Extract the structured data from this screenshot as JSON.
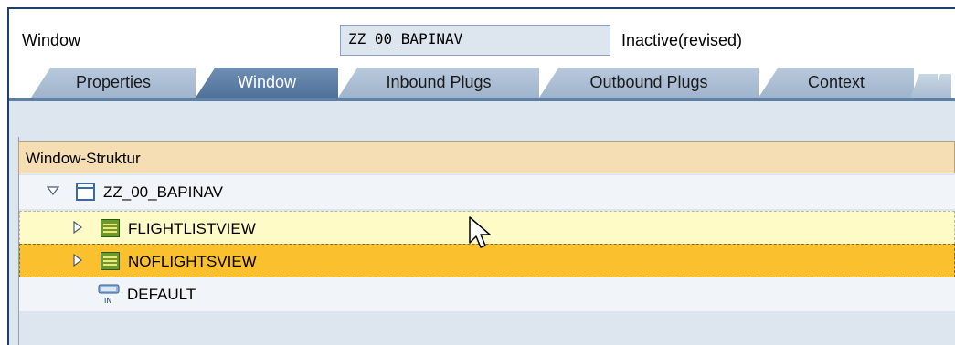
{
  "header": {
    "label": "Window",
    "input_value": "ZZ_00_BAPINAV",
    "status": "Inactive(revised)"
  },
  "tabs": [
    {
      "label": "Properties",
      "active": false
    },
    {
      "label": "Window",
      "active": true
    },
    {
      "label": "Inbound Plugs",
      "active": false
    },
    {
      "label": "Outbound Plugs",
      "active": false
    },
    {
      "label": "Context",
      "active": false
    }
  ],
  "tree": {
    "column_header": "Window-Struktur",
    "root": {
      "label": "ZZ_00_BAPINAV",
      "icon": "window-icon",
      "expanded": true
    },
    "nodes": [
      {
        "label": "FLIGHTLISTVIEW",
        "icon": "view-icon",
        "state": "hover"
      },
      {
        "label": "NOFLIGHTSVIEW",
        "icon": "view-icon",
        "state": "selected"
      },
      {
        "label": "DEFAULT",
        "icon": "inbound-plug-icon",
        "state": "normal"
      }
    ]
  },
  "colors": {
    "tab_active": "#4f7099",
    "tab_inactive": "#9fb4cd",
    "panel_bg": "#dde6ef",
    "tree_header_bg": "#f5deb3",
    "hover_row": "#fffbc6",
    "selected_row": "#fbc02d"
  }
}
